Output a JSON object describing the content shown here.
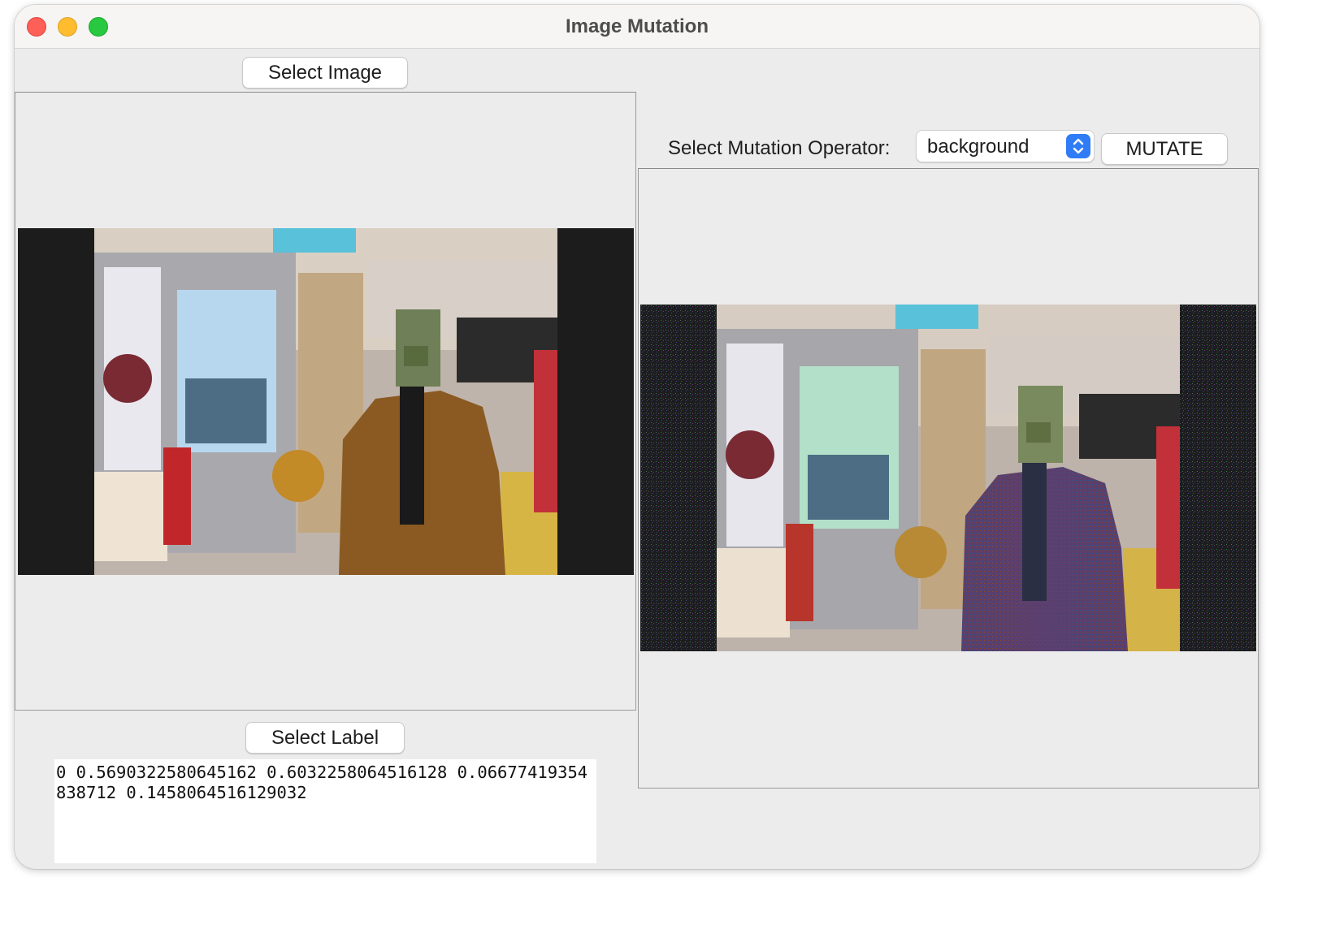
{
  "window": {
    "title": "Image Mutation"
  },
  "left": {
    "select_image_label": "Select Image",
    "select_label_label": "Select Label",
    "label_text": "0 0.5690322580645162 0.6032258064516128 0.06677419354838712 0.1458064516129032"
  },
  "right": {
    "operator_label": "Select Mutation Operator:",
    "operator_value": "background",
    "mutate_label": "MUTATE"
  },
  "colors": {
    "close": "#fe5f57",
    "minimize": "#febc2e",
    "maximize": "#28c840",
    "select_accent": "#2f7cf6",
    "coat": "#8a5a22",
    "mutated_coat": "#5a3f6e"
  },
  "icons": {
    "select_arrows": "chevron-up-down-icon"
  }
}
